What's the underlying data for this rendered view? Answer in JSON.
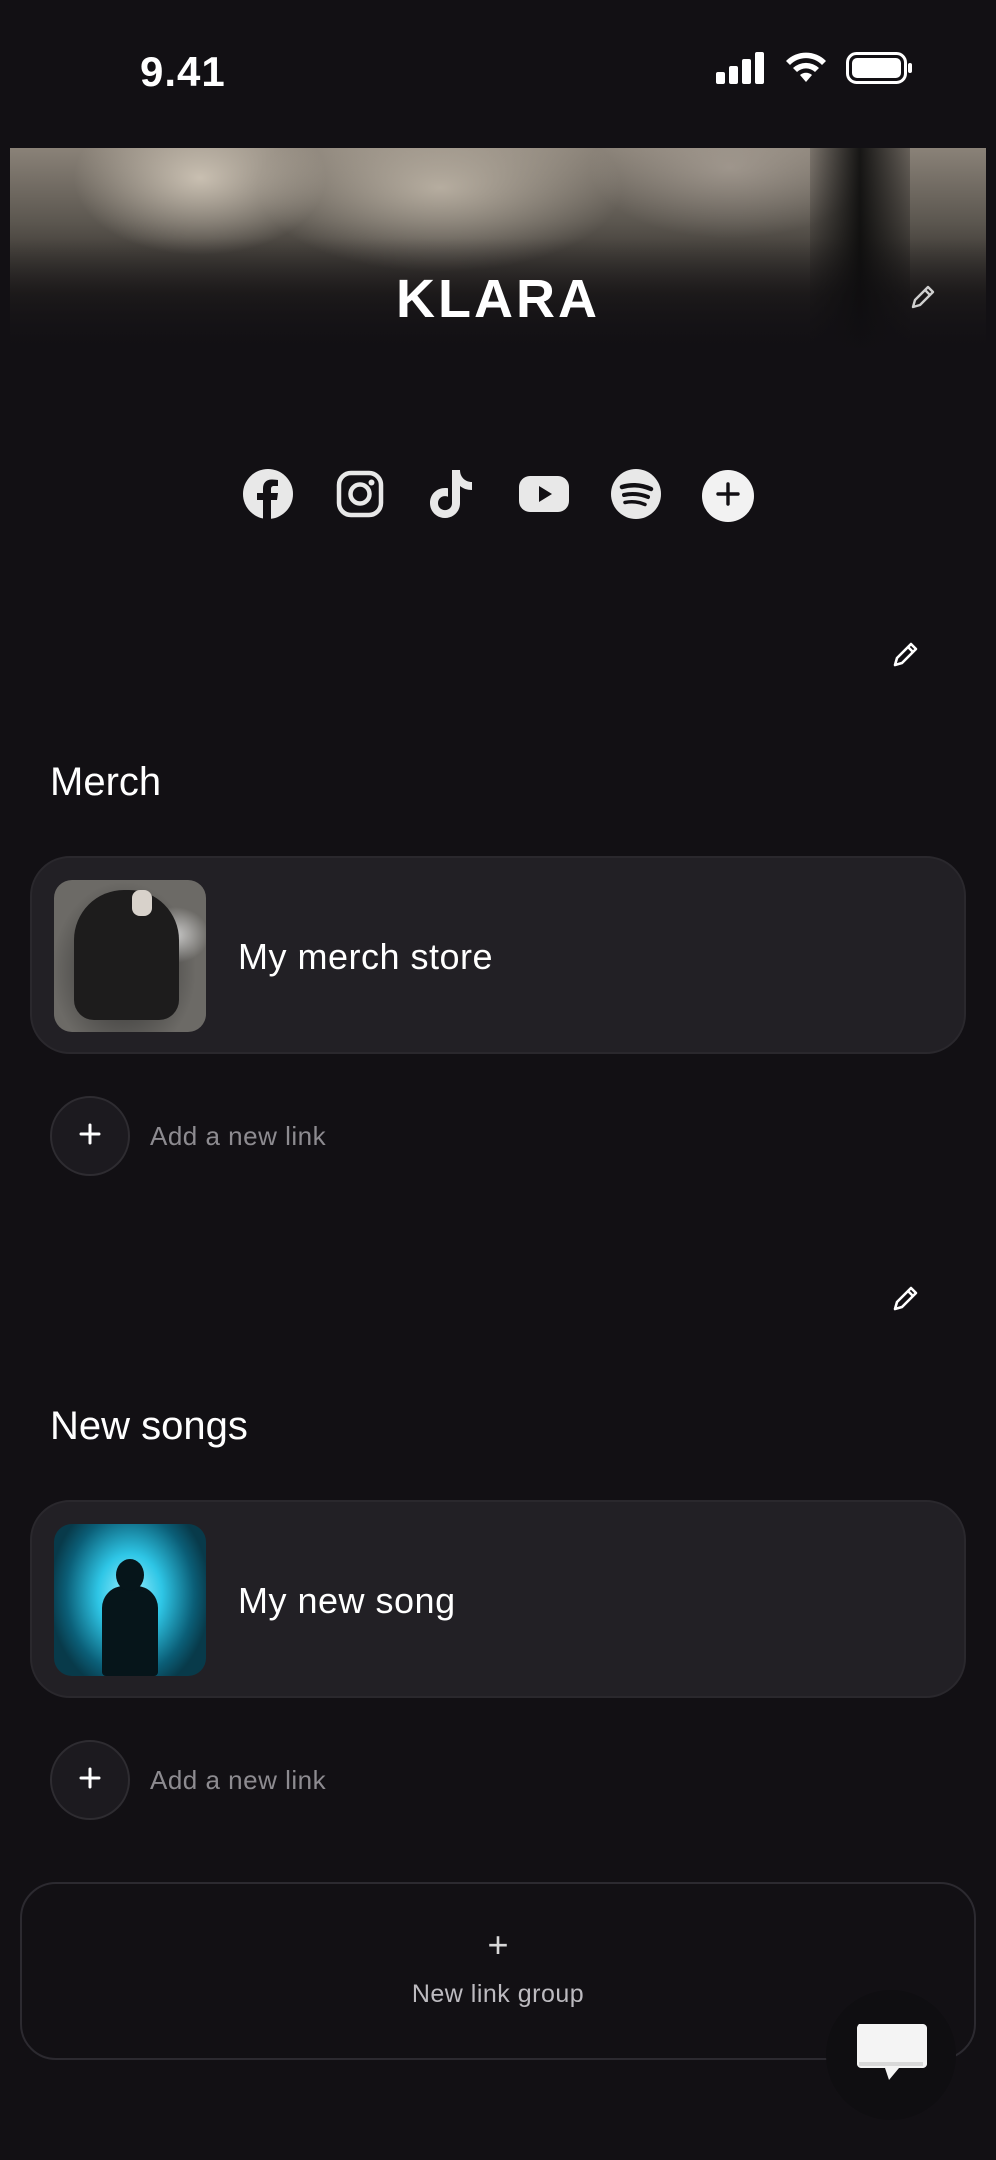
{
  "status_bar": {
    "time": "9.41",
    "icons": [
      "cellular-signal-icon",
      "wifi-icon",
      "battery-icon"
    ]
  },
  "profile": {
    "name": "KLARA",
    "edit_icon": "pencil-icon"
  },
  "socials": [
    {
      "name": "facebook",
      "icon": "facebook-icon"
    },
    {
      "name": "instagram",
      "icon": "instagram-icon"
    },
    {
      "name": "tiktok",
      "icon": "tiktok-icon"
    },
    {
      "name": "youtube",
      "icon": "youtube-icon"
    },
    {
      "name": "spotify",
      "icon": "spotify-icon"
    },
    {
      "name": "add",
      "icon": "plus-icon"
    }
  ],
  "groups": [
    {
      "title": "Merch",
      "links": [
        {
          "title": "My merch store",
          "thumbnail": "hooded-person-photo"
        }
      ],
      "add_link_label": "Add a new link"
    },
    {
      "title": "New songs",
      "links": [
        {
          "title": "My new song",
          "thumbnail": "silhouette-blue-photo"
        }
      ],
      "add_link_label": "Add a new link"
    }
  ],
  "new_group": {
    "plus": "+",
    "label": "New link group"
  },
  "chat": {
    "icon": "chat-bubble-icon"
  },
  "colors": {
    "background": "#121014",
    "card": "#222025",
    "text": "#ffffff",
    "muted": "#8d8b90"
  }
}
